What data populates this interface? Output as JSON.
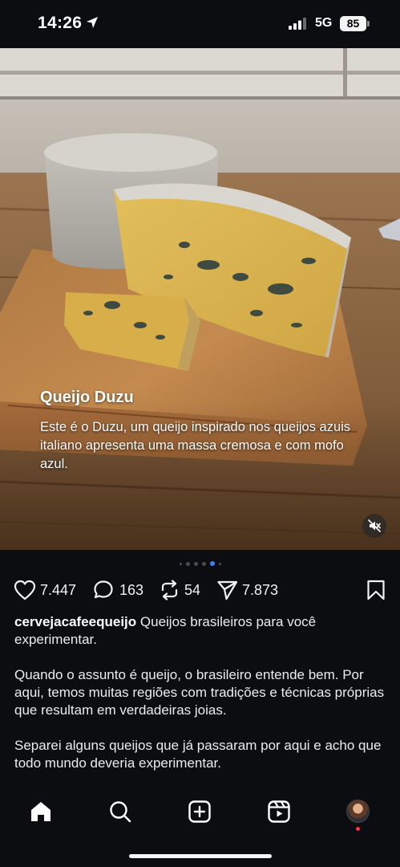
{
  "status": {
    "time": "14:26",
    "network": "5G",
    "battery": "85"
  },
  "post": {
    "caption_title": "Queijo Duzu",
    "caption_body": "Este é o Duzu, um queijo inspirado nos queijos azuis italiano apresenta uma massa cremosa e com mofo azul.",
    "media_icon": "volume-muted-icon",
    "carousel": {
      "total": 6,
      "active": 4
    }
  },
  "actions": {
    "likes": "7.447",
    "comments": "163",
    "reposts": "54",
    "shares": "7.873"
  },
  "description": {
    "username": "cervejacafeequeijo",
    "line1": "Queijos brasileiros para você experimentar.",
    "para2": "Quando o assunto é queijo, o brasileiro entende bem. Por aqui, temos muitas regiões com tradições e técnicas próprias que resultam em verdadeiras joias.",
    "para3": "Separei alguns queijos que já passaram por aqui e acho que todo mundo deveria experimentar."
  },
  "nav": {
    "items": [
      "home-icon",
      "search-icon",
      "create-icon",
      "reels-icon",
      "profile-avatar"
    ]
  },
  "colors": {
    "background": "#0c0d11",
    "accent_dot": "#3b82f6",
    "notification": "#ff3040"
  }
}
